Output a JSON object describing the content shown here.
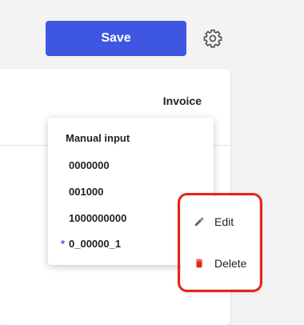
{
  "toolbar": {
    "save_label": "Save"
  },
  "card": {
    "title": "Invoice"
  },
  "dropdown": {
    "header": "Manual input",
    "items": [
      {
        "label": "0000000",
        "starred": false
      },
      {
        "label": "001000",
        "starred": false
      },
      {
        "label": "1000000000",
        "starred": false
      },
      {
        "label": "0_00000_1",
        "starred": true,
        "marker": "*"
      }
    ]
  },
  "context_menu": {
    "items": [
      {
        "label": "Edit",
        "icon": "pencil-icon"
      },
      {
        "label": "Delete",
        "icon": "trash-icon"
      }
    ]
  },
  "colors": {
    "accent": "#3f57e0",
    "highlight": "#e8241a",
    "delete_icon": "#e8241a",
    "edit_icon": "#666666"
  }
}
